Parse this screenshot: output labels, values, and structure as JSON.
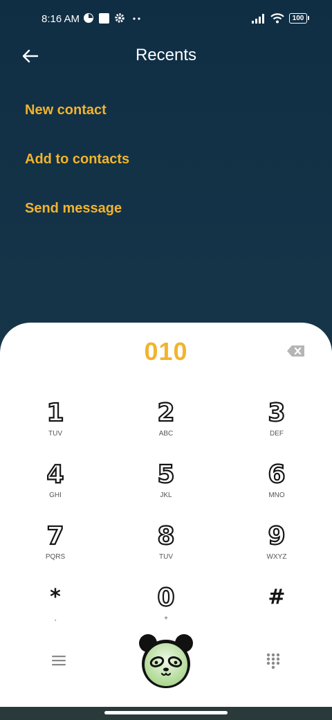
{
  "status_bar": {
    "time": "8:16 AM",
    "battery": "100",
    "icons": [
      "data-saver-icon",
      "square-notification-icon",
      "gear-icon",
      "more-dots-icon",
      "signal-icon",
      "wifi-icon",
      "battery-icon"
    ]
  },
  "header": {
    "title": "Recents",
    "back_icon": "arrow-left-icon"
  },
  "menu": {
    "items": [
      {
        "label": "New contact"
      },
      {
        "label": "Add to contacts"
      },
      {
        "label": "Send message"
      }
    ]
  },
  "dialer": {
    "number": "010",
    "accent_color": "#f2b42c",
    "keys": [
      {
        "digit": "1",
        "letters": "TUV"
      },
      {
        "digit": "2",
        "letters": "ABC"
      },
      {
        "digit": "3",
        "letters": "DEF"
      },
      {
        "digit": "4",
        "letters": "GHI"
      },
      {
        "digit": "5",
        "letters": "JKL"
      },
      {
        "digit": "6",
        "letters": "MNO"
      },
      {
        "digit": "7",
        "letters": "PQRS"
      },
      {
        "digit": "8",
        "letters": "TUV"
      },
      {
        "digit": "9",
        "letters": "WXYZ"
      },
      {
        "digit": "*",
        "letters": ","
      },
      {
        "digit": "0",
        "letters": "+"
      },
      {
        "digit": "#",
        "letters": ""
      }
    ]
  }
}
